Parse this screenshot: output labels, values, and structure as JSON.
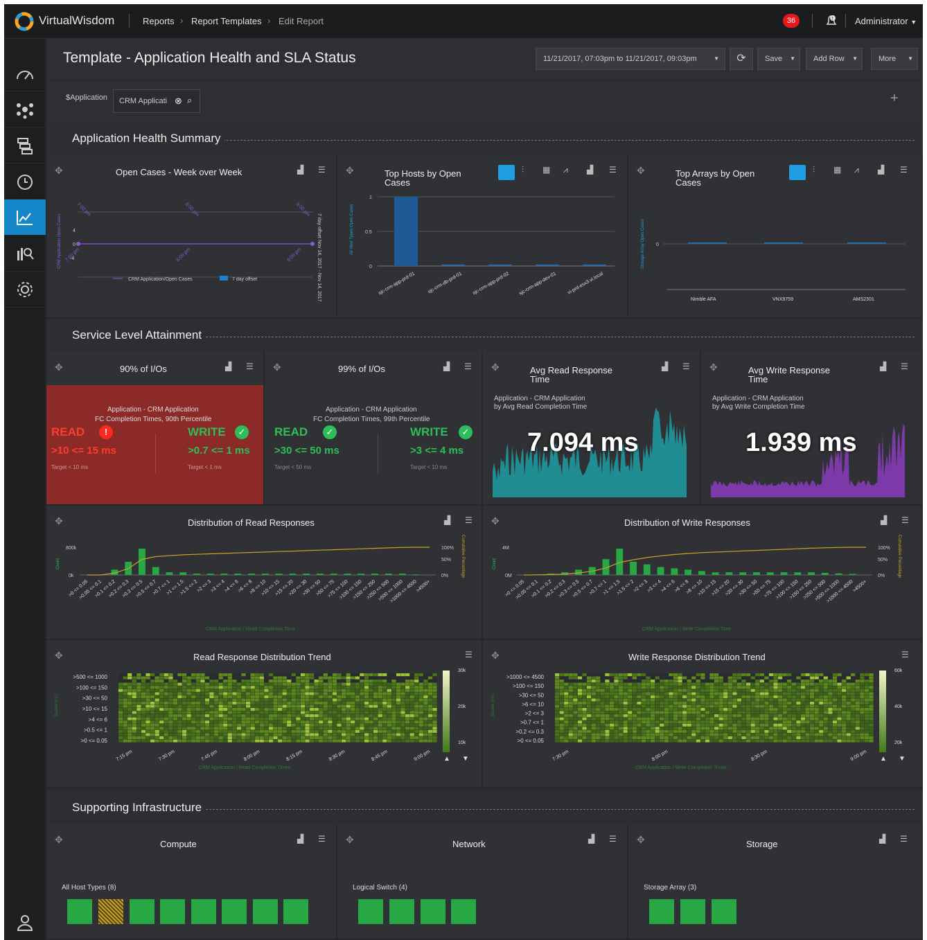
{
  "header": {
    "brand": "VirtualWisdom",
    "breadcrumb": [
      "Reports",
      "Report Templates",
      "Edit Report"
    ],
    "alerts": "36",
    "user": "Administrator"
  },
  "page": {
    "title": "Template - Application Health and SLA Status",
    "date_range": "11/21/2017, 07:03pm to 11/21/2017, 09:03pm",
    "save": "Save",
    "add_row": "Add Row",
    "more": "More"
  },
  "filter": {
    "label": "$Application",
    "value": "CRM Applicati"
  },
  "sections": {
    "health": "Application Health Summary",
    "sla": "Service Level Attainment",
    "infra": "Supporting Infrastructure"
  },
  "open_cases": {
    "title": "Open Cases - Week over Week",
    "top_labels": [
      "7:00 pm",
      "8:00 pm",
      "9:00 pm"
    ],
    "bottom_labels": [
      "7:00 pm",
      "8:00 pm",
      "9:00 pm"
    ],
    "yticks": [
      "4",
      "0",
      "-4"
    ],
    "ylabel": "CRM Application Open Cases",
    "y2label": "7 day offset Nov 14, 2017 - Nov 14, 2017",
    "legend1": "CRM Application/Open Cases",
    "legend2": "7 day offset"
  },
  "top_hosts": {
    "title1": "Top Hosts by Open",
    "title2": "Cases",
    "ylabel": "All Host Types Open Cases",
    "yticks": [
      "1",
      "0.5",
      "0"
    ],
    "categories": [
      "sjc-crm-app-prd-01",
      "sjc-crm-db-prd-01",
      "sjc-crm-app-prd-02",
      "sjc-crm-app-dev-01",
      "vi-prd-esx3.vi.local"
    ]
  },
  "top_arrays": {
    "title1": "Top Arrays by Open",
    "title2": "Cases",
    "ylabel": "Storage Array Open Cases",
    "ytick": "0",
    "categories": [
      "Nimble AFA",
      "VNX9759",
      "AMS2301"
    ]
  },
  "sla90": {
    "title": "90% of I/Os",
    "sub1": "Application - CRM Application",
    "sub2": "FC Completion Times, 90th Percentile",
    "read": "READ",
    "read_val": ">10 <= 15 ms",
    "read_target": "Target < 10 ms",
    "write": "WRITE",
    "write_val": ">0.7 <= 1 ms",
    "write_target": "Target < 1 ms"
  },
  "sla99": {
    "title": "99% of I/Os",
    "sub1": "Application - CRM Application",
    "sub2": "FC Completion Times, 99th Percentile",
    "read": "READ",
    "read_val": ">30 <= 50 ms",
    "read_target": "Target < 50 ms",
    "write": "WRITE",
    "write_val": ">3 <= 4 ms",
    "write_target": "Target < 10 ms"
  },
  "avg_read": {
    "title1": "Avg Read Response",
    "title2": "Time",
    "sub1": "Application - CRM Application",
    "sub2": "by Avg Read Completion Time",
    "value": "7.094 ms"
  },
  "avg_write": {
    "title1": "Avg Write Response",
    "title2": "Time",
    "sub1": "Application - CRM Application",
    "sub2": "by Avg Write Completion Time",
    "value": "1.939 ms"
  },
  "dist_read": {
    "title": "Distribution of Read Responses",
    "yticks": [
      "800k",
      "0k"
    ],
    "pticks": [
      "100%",
      "50%",
      "0%"
    ],
    "ylabel": "Count",
    "y2label": "Cumulative Percentage",
    "xlabel": "CRM Application / Read Completion Time",
    "buckets": [
      ">0 <= 0.05",
      ">0.05 <= 0.1",
      ">0.1 <= 0.2",
      ">0.2 <= 0.3",
      ">0.3 <= 0.5",
      ">0.5 <= 0.7",
      ">0.7 <= 1",
      ">1 <= 1.5",
      ">1.5 <= 2",
      ">2 <= 3",
      ">3 <= 4",
      ">4 <= 6",
      ">6 <= 8",
      ">8 <= 10",
      ">10 <= 15",
      ">15 <= 20",
      ">20 <= 30",
      ">30 <= 50",
      ">50 <= 75",
      ">75 <= 100",
      ">100 <= 150",
      ">150 <= 250",
      ">250 <= 500",
      ">500 <= 1000",
      ">1000 <= 4500",
      ">4500+"
    ]
  },
  "dist_write": {
    "title": "Distribution of Write Responses",
    "yticks": [
      "4M",
      "0M"
    ],
    "pticks": [
      "100%",
      "50%",
      "0%"
    ],
    "ylabel": "Count",
    "y2label": "Cumulative Percentage",
    "xlabel": "CRM Application / Write Completion Time"
  },
  "trend_read": {
    "title": "Read Response Distribution Trend",
    "rows": [
      ">500 <= 1000",
      ">100 <= 150",
      ">30 <= 50",
      ">10 <= 15",
      ">4 <= 6",
      ">0.5 <= 1",
      ">0 <= 0.05"
    ],
    "xticks": [
      "7:15 pm",
      "7:30 pm",
      "7:45 pm",
      "8:00 pm",
      "8:15 pm",
      "8:30 pm",
      "8:45 pm",
      "9:00 pm"
    ],
    "scale": [
      "30k",
      "20k",
      "10k"
    ],
    "ylabel": "Bucket (ms)",
    "xlabel": "CRM Application / Read Completion Times"
  },
  "trend_write": {
    "title": "Write Response Distribution Trend",
    "rows": [
      ">1000 <= 4500",
      ">100 <= 150",
      ">30 <= 50",
      ">6 <= 10",
      ">2 <= 3",
      ">0.7 <= 1",
      ">0.2 <= 0.3",
      ">0 <= 0.05"
    ],
    "xticks": [
      "7:30 pm",
      "8:00 pm",
      "8:30 pm",
      "9:00 pm"
    ],
    "scale": [
      "60k",
      "40k",
      "20k"
    ],
    "ylabel": "Bucket (ms)",
    "xlabel": "CRM Application / Write Completion Times"
  },
  "compute": {
    "title": "Compute",
    "label": "All Host Types (8)"
  },
  "network": {
    "title": "Network",
    "label": "Logical Switch (4)"
  },
  "storage": {
    "title": "Storage",
    "label": "Storage Array (3)"
  },
  "colors": {
    "accent": "#1587c9",
    "ok": "#27a844",
    "bad": "#d7252b",
    "teal": "#1f8d92",
    "purple": "#7b3aa8"
  }
}
